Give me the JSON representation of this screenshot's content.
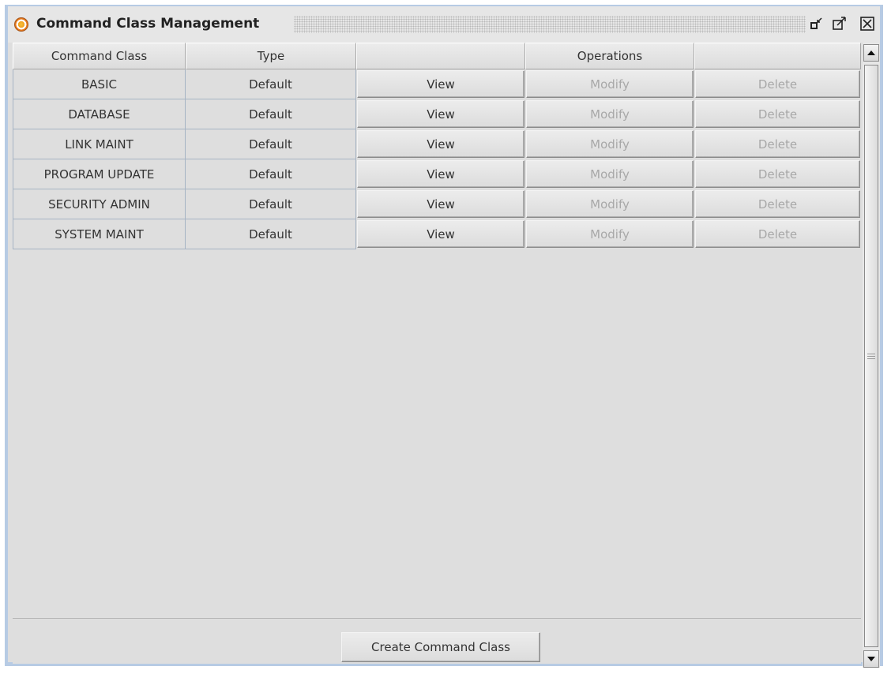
{
  "window": {
    "title": "Command Class Management",
    "controls": {
      "restore_icon": "restore-down-icon",
      "maximize_icon": "maximize-icon",
      "close_icon": "close-icon"
    }
  },
  "table": {
    "headers": [
      "Command Class",
      "Type",
      "",
      "Operations",
      ""
    ],
    "rows": [
      {
        "command_class": "BASIC",
        "type": "Default",
        "view": "View",
        "modify": "Modify",
        "delete": "Delete"
      },
      {
        "command_class": "DATABASE",
        "type": "Default",
        "view": "View",
        "modify": "Modify",
        "delete": "Delete"
      },
      {
        "command_class": "LINK MAINT",
        "type": "Default",
        "view": "View",
        "modify": "Modify",
        "delete": "Delete"
      },
      {
        "command_class": "PROGRAM UPDATE",
        "type": "Default",
        "view": "View",
        "modify": "Modify",
        "delete": "Delete"
      },
      {
        "command_class": "SECURITY ADMIN",
        "type": "Default",
        "view": "View",
        "modify": "Modify",
        "delete": "Delete"
      },
      {
        "command_class": "SYSTEM MAINT",
        "type": "Default",
        "view": "View",
        "modify": "Modify",
        "delete": "Delete"
      }
    ]
  },
  "footer": {
    "create_label": "Create Command Class"
  }
}
